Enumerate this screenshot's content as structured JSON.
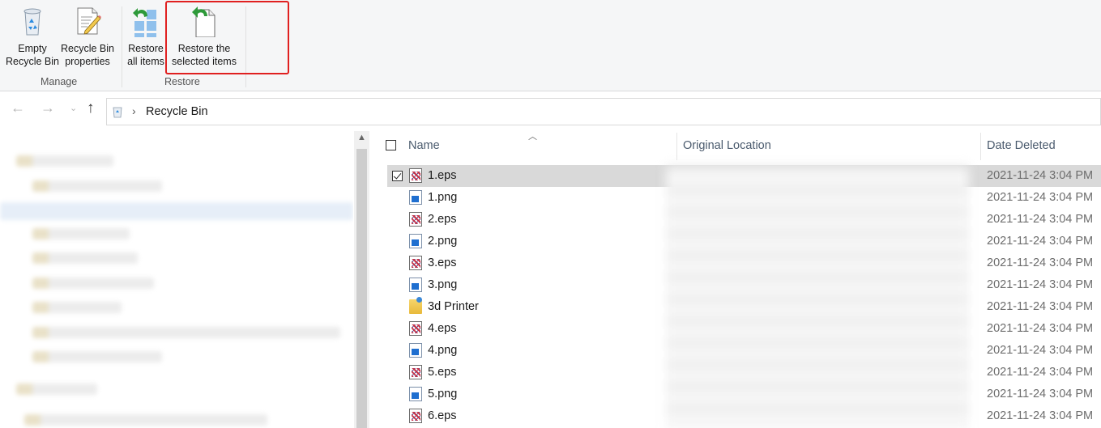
{
  "ribbon": {
    "manage": {
      "group_label": "Manage",
      "empty_line1": "Empty",
      "empty_line2": "Recycle Bin",
      "props_line1": "Recycle Bin",
      "props_line2": "properties"
    },
    "restore": {
      "group_label": "Restore",
      "all_line1": "Restore",
      "all_line2": "all items",
      "sel_line1": "Restore the",
      "sel_line2": "selected items"
    }
  },
  "address": {
    "path": "Recycle Bin",
    "back_icon": "arrow-left-icon",
    "forward_icon": "arrow-right-icon",
    "up_icon": "arrow-up-icon"
  },
  "list": {
    "headers": {
      "name": "Name",
      "original_location": "Original Location",
      "date_deleted": "Date Deleted"
    },
    "rows": [
      {
        "name": "1.eps",
        "type": "eps",
        "date": "2021-11-24 3:04 PM",
        "selected": true
      },
      {
        "name": "1.png",
        "type": "png",
        "date": "2021-11-24 3:04 PM"
      },
      {
        "name": "2.eps",
        "type": "eps",
        "date": "2021-11-24 3:04 PM"
      },
      {
        "name": "2.png",
        "type": "png",
        "date": "2021-11-24 3:04 PM"
      },
      {
        "name": "3.eps",
        "type": "eps",
        "date": "2021-11-24 3:04 PM"
      },
      {
        "name": "3.png",
        "type": "png",
        "date": "2021-11-24 3:04 PM"
      },
      {
        "name": "3d Printer",
        "type": "folder",
        "date": "2021-11-24 3:04 PM"
      },
      {
        "name": "4.eps",
        "type": "eps",
        "date": "2021-11-24 3:04 PM"
      },
      {
        "name": "4.png",
        "type": "png",
        "date": "2021-11-24 3:04 PM"
      },
      {
        "name": "5.eps",
        "type": "eps",
        "date": "2021-11-24 3:04 PM"
      },
      {
        "name": "5.png",
        "type": "png",
        "date": "2021-11-24 3:04 PM"
      },
      {
        "name": "6.eps",
        "type": "eps",
        "date": "2021-11-24 3:04 PM"
      }
    ]
  },
  "colors": {
    "highlight_border": "#e02020",
    "selected_row": "#d9d9d9",
    "restore_arrow": "#2e9a3a"
  }
}
